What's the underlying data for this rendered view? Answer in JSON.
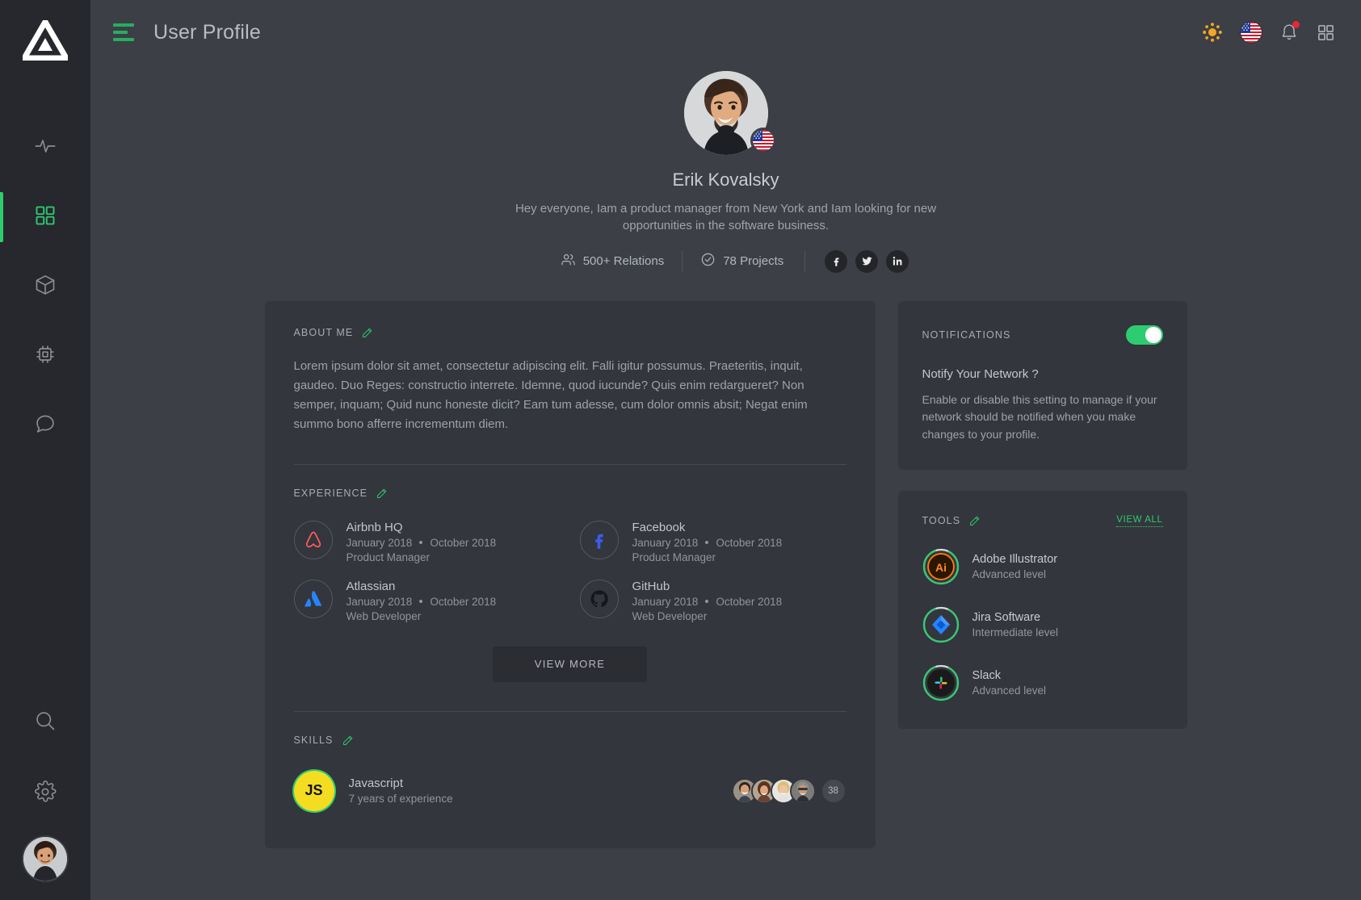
{
  "sidebar": {
    "logo_name": "triangle-logo",
    "items": [
      {
        "name": "activity-pulse",
        "icon": "pulse-icon",
        "active": false
      },
      {
        "name": "dashboard",
        "icon": "grid-icon",
        "active": true
      },
      {
        "name": "packages",
        "icon": "cube-icon",
        "active": false
      },
      {
        "name": "hardware",
        "icon": "chip-icon",
        "active": false
      },
      {
        "name": "messages",
        "icon": "chat-bubble-icon",
        "active": false
      }
    ],
    "bottom_items": [
      {
        "name": "search",
        "icon": "search-icon"
      },
      {
        "name": "settings",
        "icon": "gear-icon"
      }
    ]
  },
  "topbar": {
    "menu_icon": "hamburger-icon",
    "title": "User Profile",
    "theme_icon": "sun-icon",
    "language_icon": "us-flag-icon",
    "notifications_icon": "bell-icon",
    "apps_icon": "grid-apps-icon",
    "has_notification_dot": true
  },
  "profile": {
    "name": "Erik Kovalsky",
    "bio": "Hey everyone,  Iam a product manager from New York and Iam looking for new opportunities in the software business.",
    "country_flag": "us-flag-icon",
    "stats": [
      {
        "icon": "people-icon",
        "label": "500+ Relations"
      },
      {
        "icon": "check-circle-icon",
        "label": "78 Projects"
      }
    ],
    "socials": [
      {
        "name": "facebook",
        "glyph": "f"
      },
      {
        "name": "twitter",
        "glyph": "t"
      },
      {
        "name": "linkedin",
        "glyph": "in"
      }
    ]
  },
  "about": {
    "title": "ABOUT ME",
    "edit_icon": "pencil-icon",
    "text": "Lorem ipsum dolor sit amet, consectetur adipiscing elit. Falli igitur possumus. Praeteritis, inquit, gaudeo. Duo Reges: constructio interrete. Idemne, quod iucunde? Quis enim redargueret? Non semper, inquam; Quid nunc honeste dicit? Eam tum adesse, cum dolor omnis absit; Negat enim summo bono afferre incrementum diem."
  },
  "experience": {
    "title": "EXPERIENCE",
    "edit_icon": "pencil-icon",
    "view_more_label": "VIEW MORE",
    "items": [
      {
        "company": "Airbnb HQ",
        "start": "January 2018",
        "end": "October 2018",
        "role": "Product Manager",
        "logo": "airbnb-logo"
      },
      {
        "company": "Facebook",
        "start": "January 2018",
        "end": "October 2018",
        "role": "Product Manager",
        "logo": "facebook-logo"
      },
      {
        "company": "Atlassian",
        "start": "January 2018",
        "end": "October 2018",
        "role": "Web Developer",
        "logo": "atlassian-logo"
      },
      {
        "company": "GitHub",
        "start": "January 2018",
        "end": "October 2018",
        "role": "Web Developer",
        "logo": "github-logo"
      }
    ]
  },
  "skills": {
    "title": "SKILLS",
    "edit_icon": "pencil-icon",
    "items": [
      {
        "badge": "JS",
        "name": "Javascript",
        "sub": "7 years of experience",
        "people_count": "38"
      }
    ]
  },
  "notifications": {
    "title": "NOTIFICATIONS",
    "enabled": true,
    "question": "Notify Your Network ?",
    "description": "Enable or disable this setting to manage if your network should be notified when you make changes to your profile."
  },
  "tools": {
    "title": "TOOLS",
    "edit_icon": "pencil-icon",
    "view_all_label": "VIEW ALL",
    "items": [
      {
        "name": "Adobe Illustrator",
        "level": "Advanced level",
        "icon": "adobe-illustrator-icon",
        "progress": 88
      },
      {
        "name": "Jira Software",
        "level": "Intermediate level",
        "icon": "jira-icon",
        "progress": 88
      },
      {
        "name": "Slack",
        "level": "Advanced level",
        "icon": "slack-icon",
        "progress": 88
      }
    ]
  },
  "colors": {
    "accent_green": "#2ecc71",
    "bg_page": "#3c3f46",
    "bg_sidebar": "#26282d",
    "bg_card": "#33363c",
    "notification_red": "#e8253a",
    "sun_orange": "#f5a623"
  }
}
